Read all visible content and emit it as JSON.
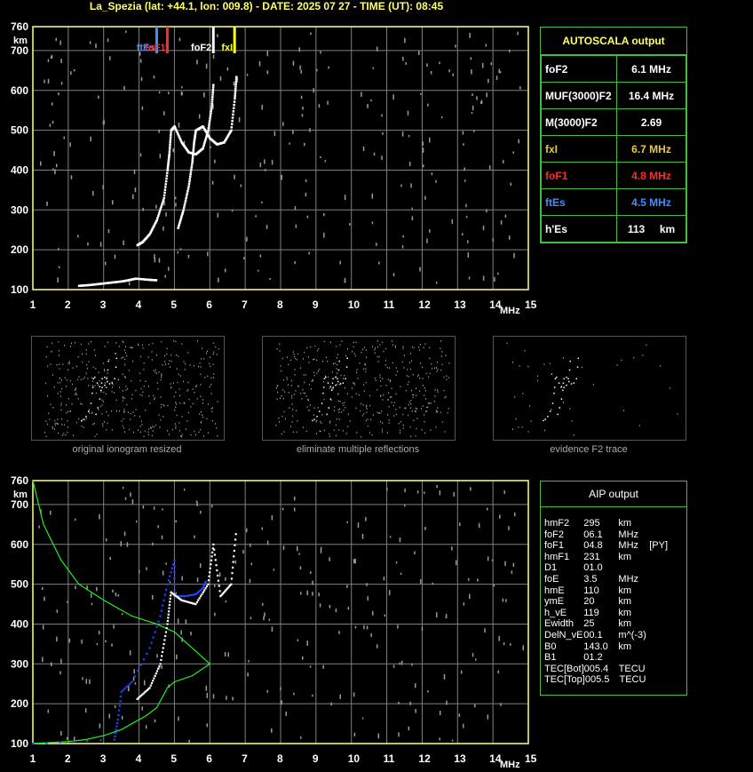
{
  "header": {
    "title": "La_Spezia (lat: +44.1, lon: 009.8) - DATE: 2025 07 27 - TIME (UT): 08:45"
  },
  "autoscala": {
    "title": "AUTOSCALA output",
    "rows": [
      {
        "key": "foF2",
        "value": "6.1 MHz",
        "color": "#ffffff"
      },
      {
        "key": "MUF(3000)F2",
        "value": "16.4 MHz",
        "color": "#ffffff"
      },
      {
        "key": "M(3000)F2",
        "value": "2.69",
        "color": "#ffffff"
      },
      {
        "key": "fxI",
        "value": "6.7 MHz",
        "color": "#e6c84a"
      },
      {
        "key": "foF1",
        "value": "4.8 MHz",
        "color": "#ff2a2a"
      },
      {
        "key": "ftEs",
        "value": "4.5 MHz",
        "color": "#3f8fff"
      },
      {
        "key": "h'Es",
        "value": "113     km",
        "color": "#ffffff"
      }
    ]
  },
  "aip": {
    "title": "AIP output",
    "rows": [
      {
        "key": "hmF2",
        "num": "295",
        "unit": "km"
      },
      {
        "key": "foF2",
        "num": "06.1",
        "unit": "MHz"
      },
      {
        "key": "foF1",
        "num": "04.8",
        "unit": "MHz    [PY]"
      },
      {
        "key": "hmF1",
        "num": "231",
        "unit": "km"
      },
      {
        "key": "D1",
        "num": "01.0",
        "unit": ""
      },
      {
        "key": "foE",
        "num": "3.5",
        "unit": "MHz"
      },
      {
        "key": "hmE",
        "num": "110",
        "unit": "km"
      },
      {
        "key": "ymE",
        "num": "20",
        "unit": "km"
      },
      {
        "key": "h_vE",
        "num": "119",
        "unit": "km"
      },
      {
        "key": "Ewidth",
        "num": "25",
        "unit": "km"
      },
      {
        "key": "DelN_vE",
        "num": "00.1",
        "unit": "m^(-3)"
      },
      {
        "key": "B0",
        "num": "143.0",
        "unit": "km"
      },
      {
        "key": "B1",
        "num": "01.2",
        "unit": ""
      },
      {
        "key": "TEC[Bot]",
        "num": "005.4",
        "unit": "TECU"
      },
      {
        "key": "TEC[Top]",
        "num": "005.5",
        "unit": "TECU"
      }
    ]
  },
  "thumbnails": [
    {
      "caption": "original ionogram resized"
    },
    {
      "caption": "eliminate multiple reflections"
    },
    {
      "caption": "evidence F2 trace"
    }
  ],
  "chart_data": [
    {
      "type": "scatter",
      "name": "ionogram-autoscala",
      "xlim": [
        1,
        15
      ],
      "ylim": [
        100,
        760
      ],
      "x_ticks": [
        "1",
        "2",
        "3",
        "4",
        "5",
        "6",
        "7",
        "8",
        "9",
        "10",
        "11",
        "12",
        "13",
        "14",
        "15"
      ],
      "y_ticks": [
        "100",
        "200",
        "300",
        "400",
        "500",
        "600",
        "700",
        "760"
      ],
      "x_unit": "MHz",
      "y_unit": "km",
      "markers": [
        {
          "label": "ftEs",
          "x": 4.5,
          "color": "#3f8fff"
        },
        {
          "label": "foF1",
          "x": 4.8,
          "color": "#ff2a2a"
        },
        {
          "label": "foF2",
          "x": 6.1,
          "color": "#ffffff"
        },
        {
          "label": "fxI",
          "x": 6.7,
          "color": "#ffff00"
        }
      ],
      "series": [
        {
          "values": [
            [
              2.3,
              110
            ],
            [
              2.6,
              112
            ],
            [
              2.9,
              115
            ],
            [
              3.2,
              118
            ],
            [
              3.5,
              121
            ],
            [
              3.7,
              124
            ],
            [
              3.9,
              128
            ],
            [
              4.3,
              125
            ],
            [
              4.5,
              124
            ]
          ]
        },
        {
          "values": [
            [
              3.95,
              212
            ],
            [
              4.1,
              220
            ],
            [
              4.3,
              240
            ],
            [
              4.5,
              275
            ],
            [
              4.7,
              330
            ],
            [
              4.8,
              400
            ],
            [
              4.85,
              440
            ],
            [
              4.9,
              500
            ],
            [
              5.0,
              510
            ],
            [
              5.2,
              470
            ],
            [
              5.4,
              445
            ],
            [
              5.6,
              440
            ],
            [
              5.8,
              455
            ],
            [
              5.95,
              500
            ],
            [
              6.05,
              560
            ],
            [
              6.1,
              620
            ]
          ]
        },
        {
          "values": [
            [
              5.1,
              255
            ],
            [
              5.25,
              300
            ],
            [
              5.4,
              360
            ],
            [
              5.5,
              420
            ],
            [
              5.55,
              470
            ],
            [
              5.6,
              500
            ],
            [
              5.8,
              510
            ],
            [
              6.0,
              480
            ],
            [
              6.2,
              465
            ],
            [
              6.4,
              470
            ],
            [
              6.6,
              500
            ],
            [
              6.7,
              580
            ],
            [
              6.75,
              640
            ]
          ]
        }
      ]
    },
    {
      "type": "line",
      "name": "ionogram-aip",
      "xlim": [
        1,
        15
      ],
      "ylim": [
        100,
        760
      ],
      "x_ticks": [
        "1",
        "2",
        "3",
        "4",
        "5",
        "6",
        "7",
        "8",
        "9",
        "10",
        "11",
        "12",
        "13",
        "14",
        "15"
      ],
      "y_ticks": [
        "100",
        "200",
        "300",
        "400",
        "500",
        "600",
        "700",
        "760"
      ],
      "x_unit": "MHz",
      "y_unit": "km",
      "series": [
        {
          "color": "#22ee22",
          "values": [
            [
              1,
              760
            ],
            [
              1.3,
              650
            ],
            [
              1.8,
              560
            ],
            [
              2.3,
              500
            ],
            [
              3.0,
              460
            ],
            [
              3.8,
              420
            ],
            [
              4.5,
              400
            ],
            [
              5.0,
              380
            ],
            [
              5.5,
              340
            ],
            [
              6.0,
              300
            ],
            [
              5.5,
              270
            ],
            [
              5.0,
              255
            ],
            [
              4.8,
              240
            ],
            [
              4.5,
              190
            ],
            [
              4.2,
              170
            ],
            [
              3.8,
              150
            ],
            [
              3.5,
              135
            ],
            [
              3.0,
              120
            ],
            [
              2.5,
              110
            ],
            [
              2.0,
              105
            ],
            [
              1.0,
              100
            ]
          ]
        },
        {
          "color": "#2244ff",
          "values": [
            [
              1,
              100
            ],
            [
              3.3,
              110
            ],
            [
              3.4,
              160
            ],
            [
              3.5,
              230
            ],
            [
              3.8,
              255
            ],
            [
              4.3,
              340
            ],
            [
              4.6,
              420
            ],
            [
              4.8,
              500
            ],
            [
              5.0,
              560
            ],
            [
              5.0,
              470
            ],
            [
              5.3,
              470
            ],
            [
              5.6,
              475
            ],
            [
              5.8,
              490
            ],
            [
              5.9,
              510
            ]
          ]
        },
        {
          "color": "#ffffff",
          "values": [
            [
              3.95,
              212
            ],
            [
              4.3,
              240
            ],
            [
              4.6,
              300
            ],
            [
              4.8,
              400
            ],
            [
              4.9,
              480
            ],
            [
              5.2,
              460
            ],
            [
              5.6,
              450
            ],
            [
              5.95,
              500
            ],
            [
              6.1,
              600
            ],
            [
              6.3,
              470
            ],
            [
              6.6,
              500
            ],
            [
              6.75,
              640
            ]
          ]
        }
      ]
    }
  ]
}
